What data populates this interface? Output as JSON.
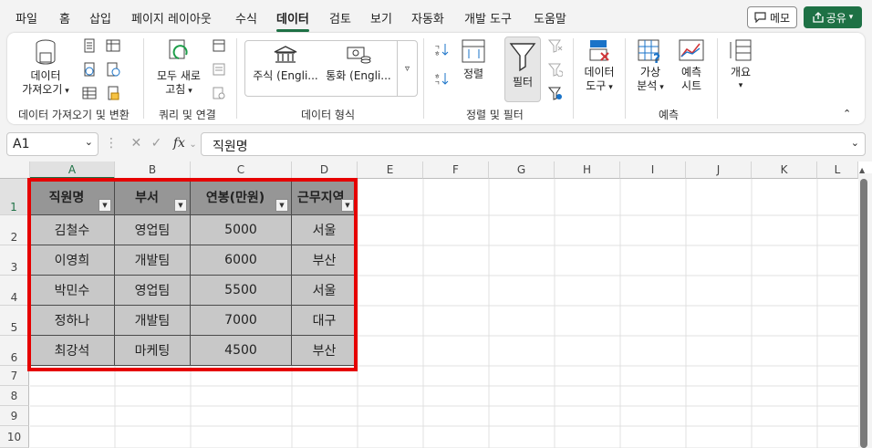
{
  "menu": {
    "tabs": [
      "파일",
      "홈",
      "삽입",
      "페이지 레이아웃",
      "수식",
      "데이터",
      "검토",
      "보기",
      "자동화",
      "개발 도구",
      "도움말"
    ],
    "active": "데이터",
    "memo_label": "메모",
    "share_label": "공유"
  },
  "ribbon": {
    "get_data": "데이터\n가져오기",
    "group_get": "데이터 가져오기 및 변환",
    "refresh_all": "모두 새로\n고침",
    "group_query": "쿼리 및 연결",
    "stocks": "주식 (Engli...",
    "currency": "통화 (Engli...",
    "group_types": "데이터 형식",
    "sort": "정렬",
    "filter": "필터",
    "group_sort": "정렬 및 필터",
    "data_tools": "데이터\n도구",
    "what_if": "가상\n분석",
    "forecast_sheet": "예측\n시트",
    "group_forecast": "예측",
    "outline": "개요"
  },
  "formula_bar": {
    "name_box": "A1",
    "formula": "직원명"
  },
  "columns": [
    "A",
    "B",
    "C",
    "D",
    "E",
    "F",
    "G",
    "H",
    "I",
    "J",
    "K",
    "L"
  ],
  "rows": [
    "1",
    "2",
    "3",
    "4",
    "5",
    "6",
    "7",
    "8",
    "9",
    "10"
  ],
  "table": {
    "headers": [
      "직원명",
      "부서",
      "연봉(만원)",
      "근무지역"
    ],
    "rows": [
      [
        "김철수",
        "영업팀",
        "5000",
        "서울"
      ],
      [
        "이영희",
        "개발팀",
        "6000",
        "부산"
      ],
      [
        "박민수",
        "영업팀",
        "5500",
        "서울"
      ],
      [
        "정하나",
        "개발팀",
        "7000",
        "대구"
      ],
      [
        "최강석",
        "마케팅",
        "4500",
        "부산"
      ]
    ]
  },
  "colors": {
    "accent": "#1e7145",
    "highlight_border": "#e60000",
    "header_fill": "#969696",
    "cell_fill": "#c8c8c8"
  }
}
